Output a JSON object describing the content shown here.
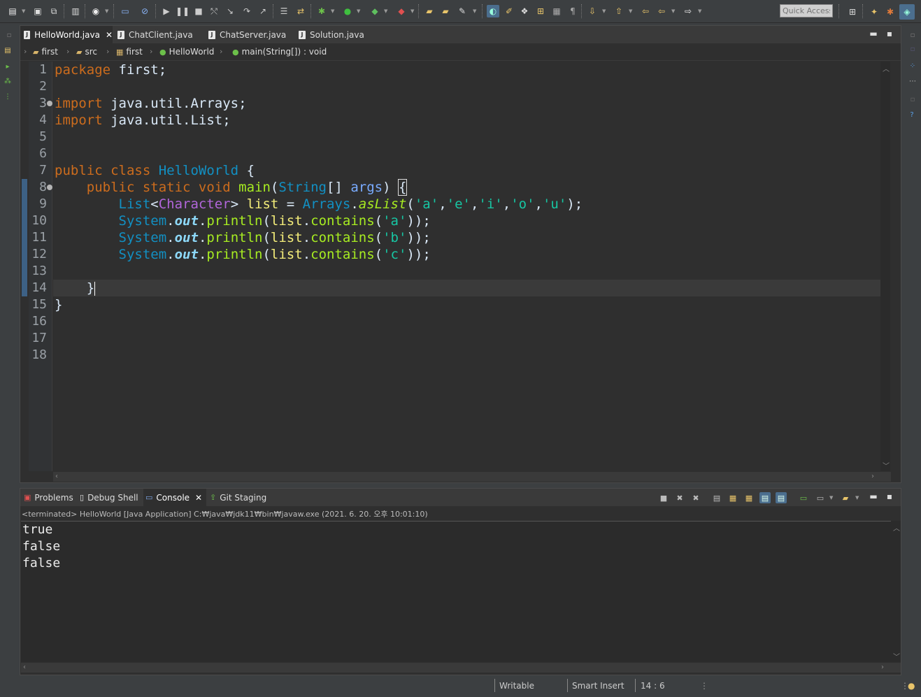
{
  "toolbar": {
    "quick_access_placeholder": "Quick Access"
  },
  "editor": {
    "tabs": [
      {
        "label": "HelloWorld.java",
        "active": true
      },
      {
        "label": "ChatClient.java",
        "active": false
      },
      {
        "label": "ChatServer.java",
        "active": false
      },
      {
        "label": "Solution.java",
        "active": false
      }
    ],
    "breadcrumb": [
      "first",
      "src",
      "first",
      "HelloWorld",
      "main(String[]) : void"
    ],
    "line_numbers": [
      "1",
      "2",
      "3",
      "4",
      "5",
      "6",
      "7",
      "8",
      "9",
      "10",
      "11",
      "12",
      "13",
      "14",
      "15",
      "16",
      "17",
      "18"
    ],
    "code": {
      "l1_kw": "package",
      "l1_rest": " first;",
      "l3_kw": "import",
      "l3_rest": " java.util.Arrays;",
      "l4_kw": "import",
      "l4_rest": " java.util.List;",
      "l7_kw": "public class",
      "l7_type": "HelloWorld",
      "l7_rest": " {",
      "l8_kw": "public static void",
      "l8_method": "main",
      "l8_p1": "(",
      "l8_type": "String",
      "l8_p2": "[] ",
      "l8_param": "args",
      "l8_p3": ") ",
      "l8_brace": "{",
      "l9_type": "List",
      "l9_lt": "<",
      "l9_gen": "Character",
      "l9_gt": "> ",
      "l9_var": "list",
      "l9_eq": " = ",
      "l9_cls": "Arrays",
      "l9_dot": ".",
      "l9_call": "asList",
      "l9_open": "(",
      "l9_s1": "'a'",
      "l9_c1": ",",
      "l9_s2": "'e'",
      "l9_c2": ",",
      "l9_s3": "'i'",
      "l9_c3": ",",
      "l9_s4": "'o'",
      "l9_c4": ",",
      "l9_s5": "'u'",
      "l9_end": ");",
      "sys": "System",
      "dot": ".",
      "out": "out",
      "println": "println",
      "open": "(",
      "var": "list",
      "contains": "contains",
      "close": "));",
      "l10_arg": "'a'",
      "l11_arg": "'b'",
      "l12_arg": "'c'",
      "l14_text": "}",
      "l15_text": "}"
    }
  },
  "console": {
    "tabs": [
      {
        "label": "Problems",
        "icon": "problems-icon"
      },
      {
        "label": "Debug Shell",
        "icon": "debug-shell-icon"
      },
      {
        "label": "Console",
        "icon": "console-icon",
        "active": true
      },
      {
        "label": "Git Staging",
        "icon": "git-staging-icon"
      }
    ],
    "description": "<terminated> HelloWorld [Java Application] C:₩java₩jdk11₩bin₩javaw.exe (2021. 6. 20. 오후 10:01:10)",
    "output": [
      "true",
      "false",
      "false"
    ]
  },
  "statusbar": {
    "writable": "Writable",
    "insert_mode": "Smart Insert",
    "position": "14 : 6"
  },
  "colors": {
    "keyword": "#cc6c1d",
    "type": "#1290c3",
    "method": "#a7ec21",
    "string": "#17c6a3",
    "variable": "#f3ec79",
    "static_field": "#8dd8f8"
  }
}
